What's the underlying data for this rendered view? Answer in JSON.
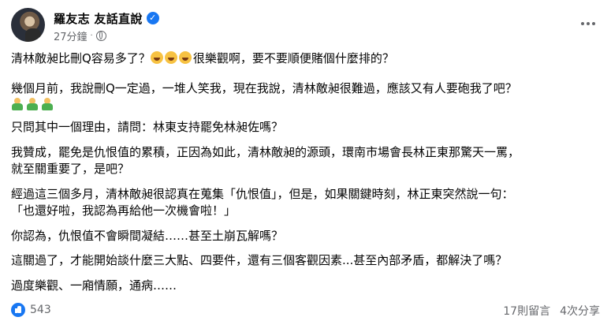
{
  "post": {
    "author": "羅友志 友話直說",
    "time": "27分鐘",
    "separator": "·",
    "paragraphs": [
      {
        "text_a": "清林敵昶比刪Q容易多了？",
        "emoji_count": 3,
        "emoji": "laughing-face-icon",
        "text_b": "很樂觀啊，要不要順便賭個什麼排的？"
      },
      {
        "text_a": "幾個月前，我說刪Q一定過，一堆人笑我，現在我說，清林敵昶很難過，應該又有人要砲我了吧？",
        "emoji_count": 3,
        "emoji": "person-gesturing-icon"
      },
      {
        "text_a": "只問其中一個理由，請問：林東支持罷免林昶佐嗎？"
      },
      {
        "text_a": "我贊成，罷免是仇恨值的累積，正因為如此，清林敵昶的源頭，環南市場會長林正東那驚天一罵，",
        "text_b": "就至關重要了，是吧？"
      },
      {
        "text_a": "經過這三個多月，清林敵昶很認真在蒐集「仇恨值」，但是，如果關鍵時刻，林正東突然說一句：",
        "text_b": "「也還好啦，我認為再給他一次機會啦！」"
      },
      {
        "text_a": "你認為，仇恨值不會瞬間凝結……甚至土崩瓦解嗎？"
      },
      {
        "text_a": "這關過了，才能開始談什麼三大點、四要件，還有三個客觀因素...甚至內部矛盾，都解決了嗎？"
      },
      {
        "text_a": "過度樂觀、一廂情願，通病……"
      }
    ],
    "reactions_count": "543",
    "comments": "17則留言",
    "shares": "4次分享"
  }
}
